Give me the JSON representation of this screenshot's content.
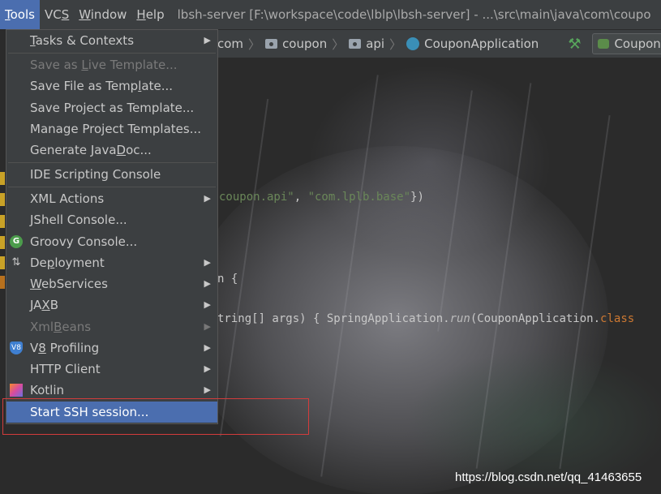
{
  "menubar": {
    "items": [
      {
        "label": "Tools",
        "mnemonic": "T"
      },
      {
        "label": "VCS",
        "mnemonic": "S"
      },
      {
        "label": "Window",
        "mnemonic": "W"
      },
      {
        "label": "Help",
        "mnemonic": "H"
      }
    ],
    "window_title": "lbsh-server [F:\\workspace\\code\\lblp\\lbsh-server] - ...\\src\\main\\java\\com\\coupo"
  },
  "navbar": {
    "crumbs": [
      "com",
      "coupon",
      "api",
      "CouponApplication"
    ],
    "run_config": "CouponAp"
  },
  "code": {
    "line1": {
      "str1": "coupon.api\"",
      "comma": ", ",
      "str2": "\"com.lplb.base\"",
      "close": "})"
    },
    "line2": "n {",
    "line3": {
      "pre": "tring[] args) { SpringApplication.",
      "method": "run",
      "mid": "(CouponApplication.",
      "kw": "class"
    }
  },
  "tools_menu": {
    "items": [
      {
        "label": "Tasks & Contexts",
        "submenu": true,
        "enabled": true
      },
      {
        "label": "Save as Live Template...",
        "enabled": false
      },
      {
        "label": "Save File as Template...",
        "enabled": true
      },
      {
        "label": "Save Project as Template...",
        "enabled": true
      },
      {
        "label": "Manage Project Templates...",
        "enabled": true
      },
      {
        "label": "Generate JavaDoc...",
        "enabled": true
      },
      {
        "label": "IDE Scripting Console",
        "enabled": true
      },
      {
        "label": "XML Actions",
        "submenu": true,
        "enabled": true
      },
      {
        "label": "JShell Console...",
        "enabled": true
      },
      {
        "label": "Groovy Console...",
        "enabled": true,
        "icon": "groovy-icon"
      },
      {
        "label": "Deployment",
        "submenu": true,
        "enabled": true,
        "icon": "deployment-icon"
      },
      {
        "label": "WebServices",
        "submenu": true,
        "enabled": true
      },
      {
        "label": "JAXB",
        "submenu": true,
        "enabled": true
      },
      {
        "label": "XmlBeans",
        "submenu": true,
        "enabled": false
      },
      {
        "label": "V8 Profiling",
        "submenu": true,
        "enabled": true,
        "icon": "v8-icon"
      },
      {
        "label": "HTTP Client",
        "submenu": true,
        "enabled": true
      },
      {
        "label": "Kotlin",
        "submenu": true,
        "enabled": true,
        "icon": "kotlin-icon"
      },
      {
        "label": "Start SSH session...",
        "enabled": true,
        "selected": true
      }
    ]
  },
  "watermark": "https://blog.csdn.net/qq_41463655",
  "colors": {
    "menu_bg": "#3c3f41",
    "selection": "#4b6eaf",
    "highlight_box": "#d33c3c",
    "string": "#6a8759",
    "keyword": "#cc7832"
  }
}
